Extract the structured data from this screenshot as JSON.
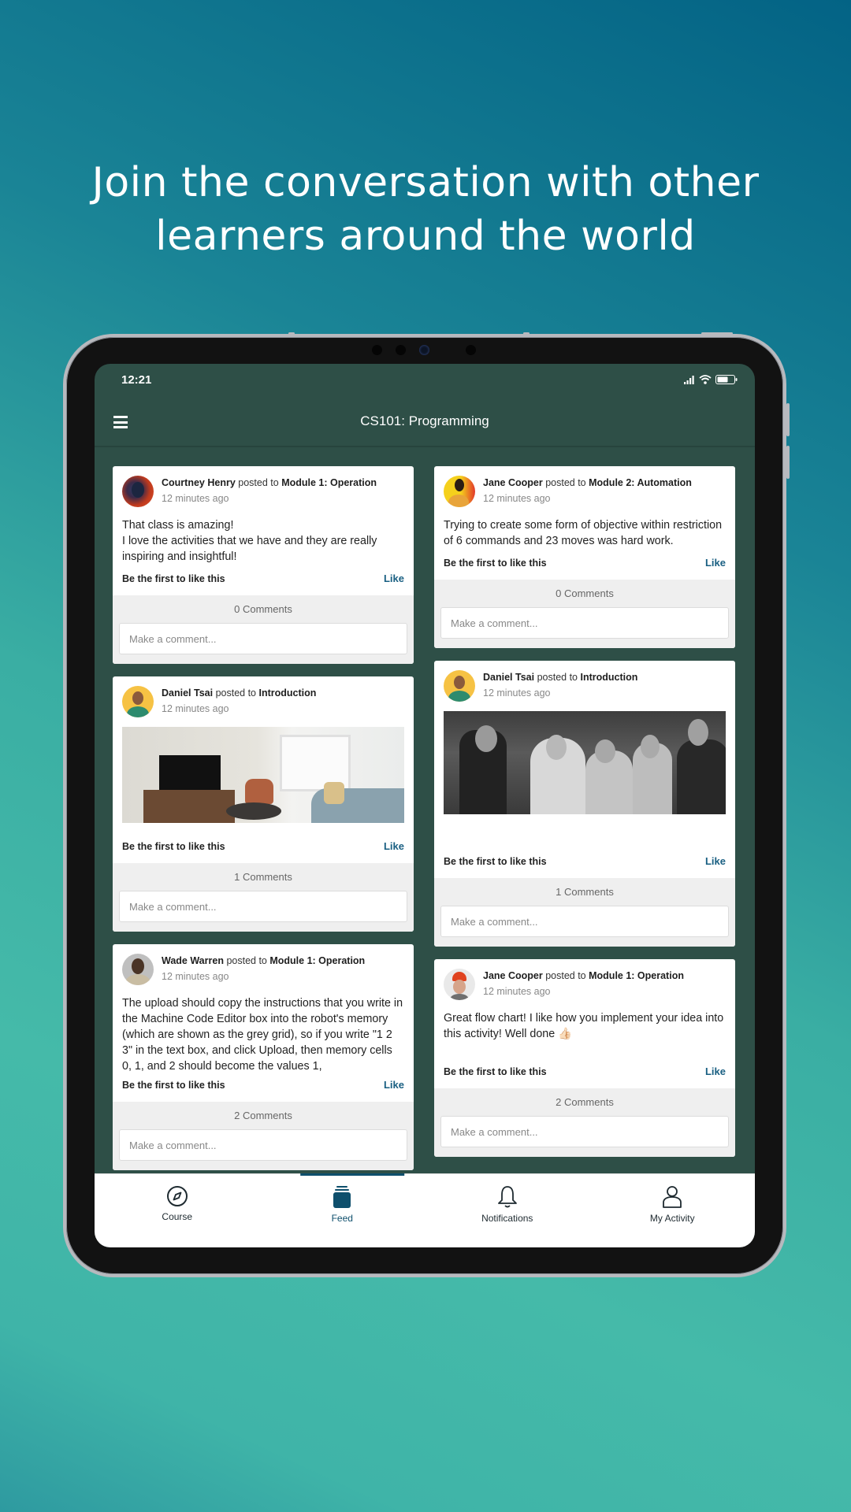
{
  "headline": {
    "line1": "Join the conversation with other",
    "line2": "learners around the world"
  },
  "status_bar": {
    "time": "12:21",
    "icons": [
      "signal-icon",
      "wifi-icon",
      "battery-icon"
    ]
  },
  "header": {
    "title": "CS101: Programming",
    "menu_icon": "hamburger-menu-icon"
  },
  "posts_left": [
    {
      "author": "Courtney Henry",
      "posted_to": "posted to",
      "module": "Module 1: Operation",
      "time": "12 minutes ago",
      "text_lines": [
        "That class is amazing!",
        "I love the activities that we have and they are really inspiring and insightful!"
      ],
      "like_status": "Be the first to like this",
      "like_label": "Like",
      "comments": "0 Comments",
      "comment_placeholder": "Make a comment..."
    },
    {
      "author": "Daniel Tsai",
      "posted_to": "posted to",
      "module": "Introduction",
      "time": "12 minutes ago",
      "image": "living-room-photo",
      "like_status": "Be the first to like this",
      "like_label": "Like",
      "comments": "1 Comments",
      "comment_placeholder": "Make a comment..."
    },
    {
      "author": "Wade Warren",
      "posted_to": "posted to",
      "module": "Module 1: Operation",
      "time": "12 minutes ago",
      "text": "The upload should copy the instructions that you write in the Machine Code Editor box into the robot's memory (which are shown as the grey grid), so if you write \"1 2 3\" in the text box, and click Upload, then memory cells 0, 1, and 2 should become the values 1,",
      "like_status": "Be the first to like this",
      "like_label": "Like",
      "comments": "2 Comments",
      "comment_placeholder": "Make a comment..."
    }
  ],
  "posts_right": [
    {
      "author": "Jane Cooper",
      "posted_to": "posted to",
      "module": "Module 2: Automation",
      "time": "12 minutes ago",
      "text": "Trying to create some form of objective within restriction of 6 commands and 23 moves was hard work.",
      "like_status": "Be the first to like this",
      "like_label": "Like",
      "comments": "0 Comments",
      "comment_placeholder": "Make a comment..."
    },
    {
      "author": "Daniel Tsai",
      "posted_to": "posted to",
      "module": "Introduction",
      "time": "12 minutes ago",
      "image": "group-party-photo",
      "like_status": "Be the first to like this",
      "like_label": "Like",
      "comments": "1 Comments",
      "comment_placeholder": "Make a comment..."
    },
    {
      "author": "Jane Cooper",
      "posted_to": "posted to",
      "module": "Module 1: Operation",
      "time": "12 minutes ago",
      "text": "Great flow chart! I like how you implement your idea into this activity! Well done 👍🏻",
      "like_status": "Be the first to like this",
      "like_label": "Like",
      "comments": "2 Comments",
      "comment_placeholder": "Make a comment..."
    }
  ],
  "bottom_nav": [
    {
      "label": "Course",
      "icon": "compass-icon",
      "active": false
    },
    {
      "label": "Feed",
      "icon": "feed-icon",
      "active": true
    },
    {
      "label": "Notifications",
      "icon": "bell-icon",
      "active": false
    },
    {
      "label": "My Activity",
      "icon": "user-icon",
      "active": false
    }
  ],
  "colors": {
    "app_bg": "#2e4f47",
    "accent": "#0e4f6c",
    "like": "#195f82"
  }
}
